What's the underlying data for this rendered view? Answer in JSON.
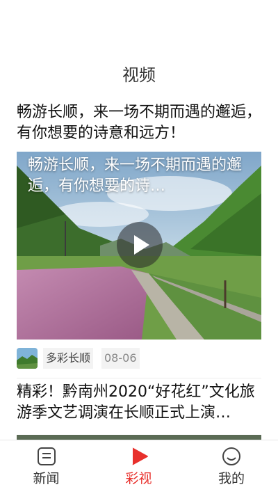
{
  "header": {
    "title": "视频"
  },
  "feed": {
    "items": [
      {
        "title": "畅游长顺，来一场不期而遇的邂逅，有你想要的诗意和远方！",
        "overlay_title": "畅游长顺，来一场不期而遇的邂逅，有你想要的诗…",
        "channel": "多彩长顺",
        "date": "08-06"
      },
      {
        "title": "精彩！黔南州2020“好花红”文化旅游季文艺调演在长顺正式上演…"
      }
    ]
  },
  "tabbar": {
    "items": [
      {
        "label": "新闻",
        "icon": "news-icon"
      },
      {
        "label": "彩视",
        "icon": "play-icon",
        "active": true
      },
      {
        "label": "我的",
        "icon": "smiley-icon"
      }
    ]
  },
  "colors": {
    "accent": "#e8302c",
    "text": "#111111",
    "meta_bg": "#f3f3f3"
  }
}
